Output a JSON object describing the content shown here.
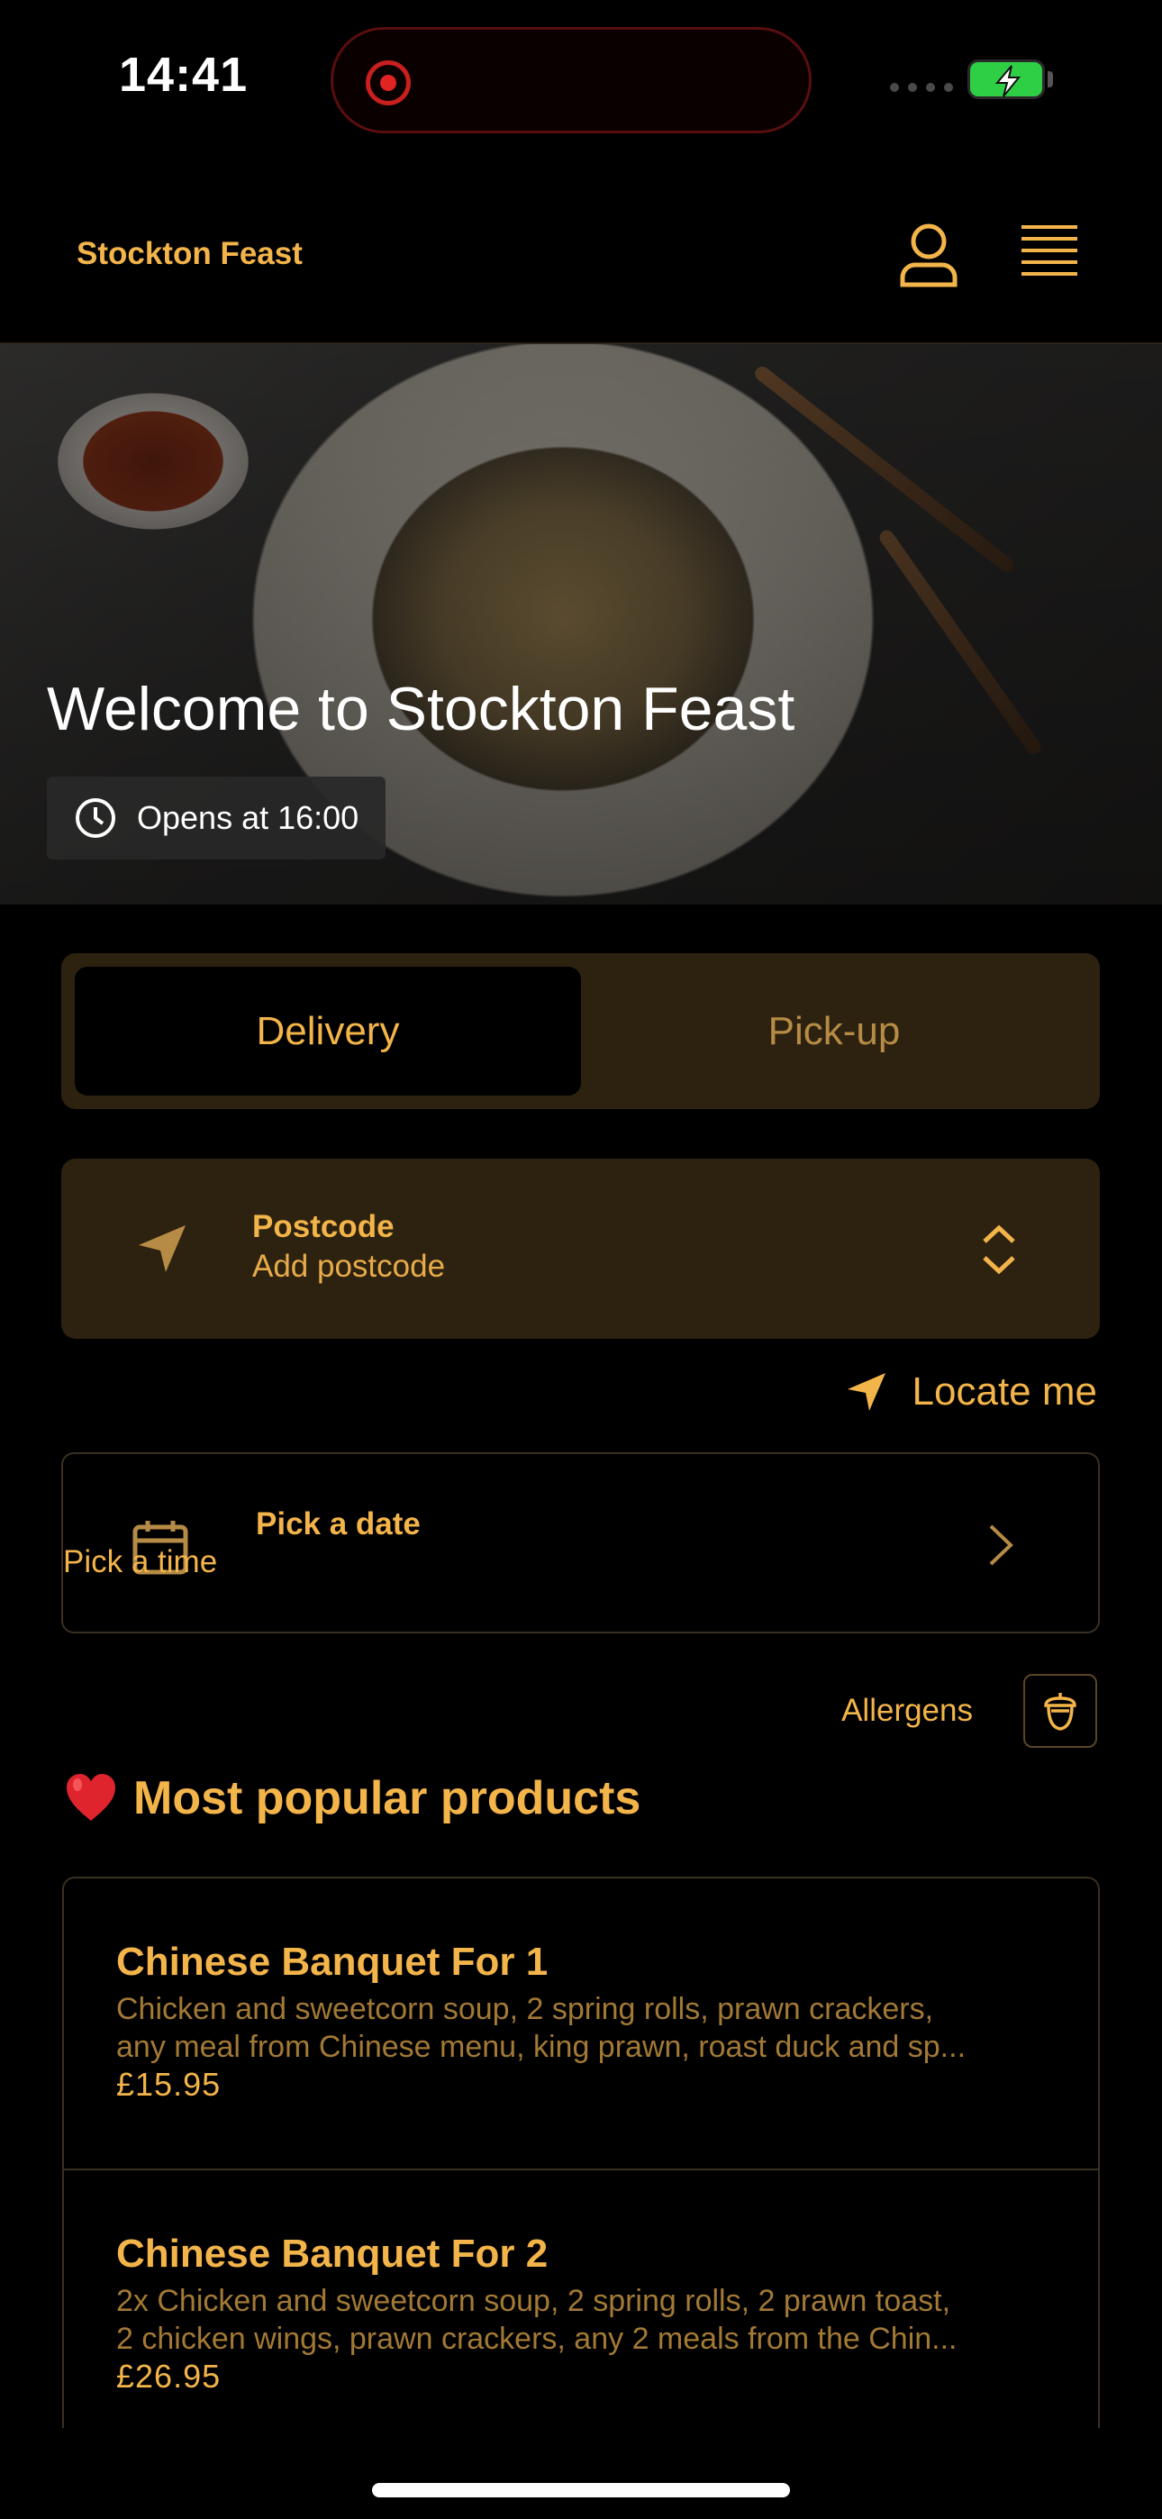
{
  "status_bar": {
    "time": "14:41"
  },
  "header": {
    "brand": "Stockton Feast"
  },
  "hero": {
    "title": "Welcome to Stockton Feast",
    "hours": "Opens at 16:00"
  },
  "order_mode": {
    "tabs": [
      {
        "label": "Delivery",
        "selected": true
      },
      {
        "label": "Pick-up",
        "selected": false
      }
    ]
  },
  "postcode": {
    "label": "Postcode",
    "placeholder": "Add postcode"
  },
  "locate": {
    "label": "Locate me"
  },
  "schedule": {
    "date_label": "Pick a date",
    "time_label": "Pick a time"
  },
  "allergens": {
    "label": "Allergens"
  },
  "popular": {
    "title": "Most popular products",
    "products": [
      {
        "name": "Chinese Banquet For 1",
        "description_line1": "Chicken and sweetcorn soup, 2 spring rolls, prawn crackers,",
        "description_line2": "any meal from Chinese menu, king prawn, roast duck and sp...",
        "price": "£15.95"
      },
      {
        "name": "Chinese Banquet For 2",
        "description_line1": "2x Chicken and sweetcorn soup, 2 spring rolls, 2 prawn toast,",
        "description_line2": "2 chicken wings, prawn crackers, any 2 meals from the Chin...",
        "price": "£26.95"
      }
    ]
  },
  "colors": {
    "accent": "#f3b44a",
    "panel": "#2d2210",
    "background": "#000000"
  }
}
